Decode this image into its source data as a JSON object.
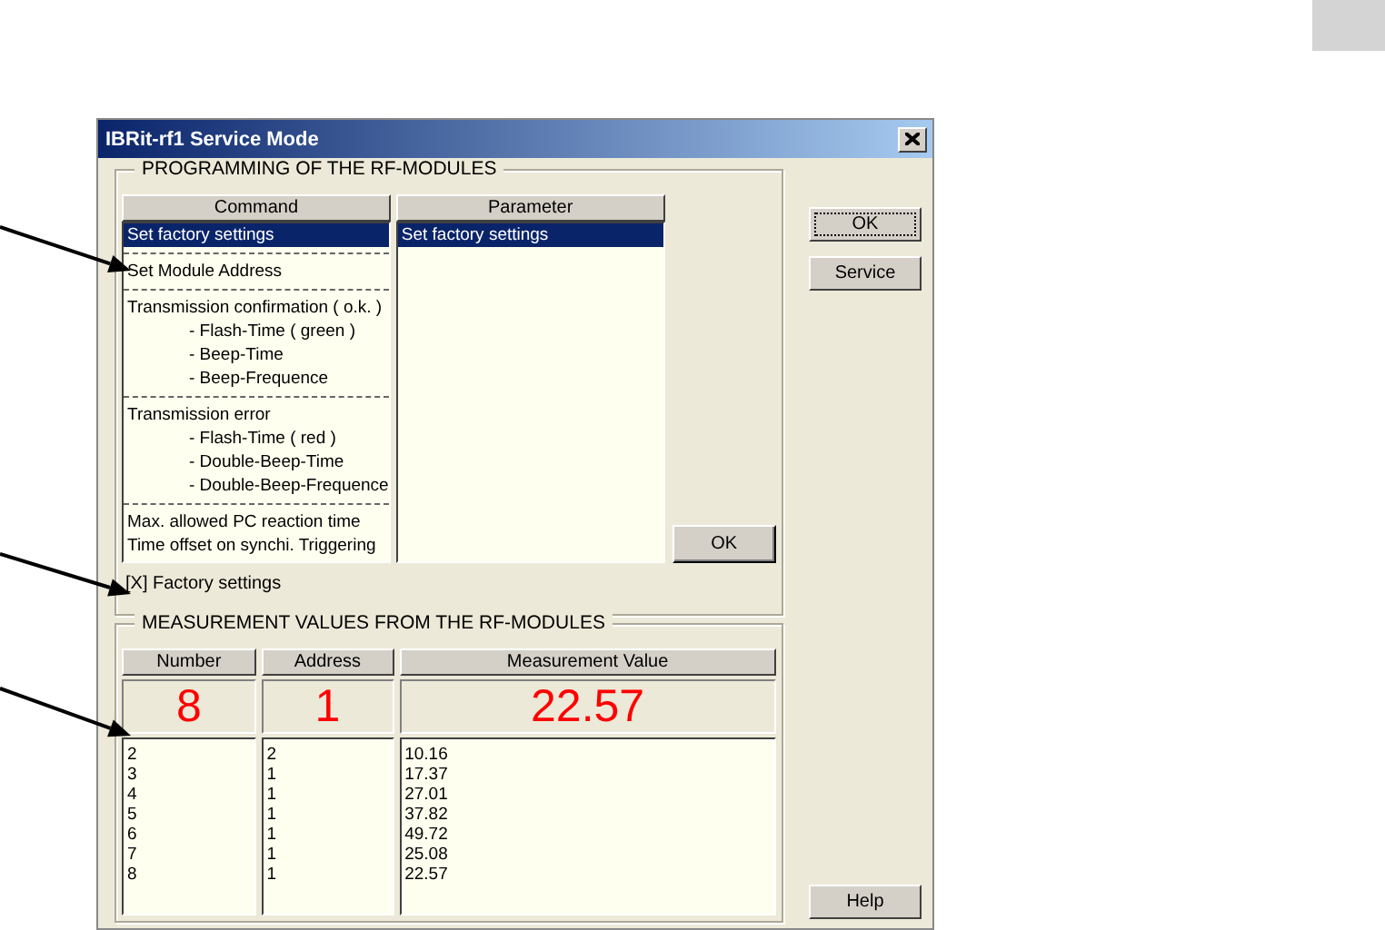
{
  "window": {
    "title": "IBRit-rf1 Service Mode"
  },
  "programming": {
    "title": "PROGRAMMING OF THE RF-MODULES",
    "columns": [
      "Command",
      "Parameter"
    ],
    "command_groups": [
      {
        "items": [
          {
            "text": "Set factory settings",
            "selected": true
          }
        ]
      },
      {
        "items": [
          {
            "text": "Set Module Address",
            "selected": false
          }
        ]
      },
      {
        "items": [
          {
            "text": "Transmission confirmation ( o.k. )",
            "selected": false,
            "children": [
              "- Flash-Time ( green )",
              "- Beep-Time",
              "- Beep-Frequence"
            ]
          }
        ]
      },
      {
        "items": [
          {
            "text": "Transmission error",
            "selected": false,
            "children": [
              "- Flash-Time ( red )",
              "- Double-Beep-Time",
              "- Double-Beep-Frequence"
            ]
          }
        ]
      },
      {
        "items": [
          {
            "text": "Max. allowed PC reaction time",
            "selected": false
          },
          {
            "text": "Time offset on synchi. Triggering",
            "selected": false
          }
        ]
      }
    ],
    "parameters": [
      {
        "text": "Set factory settings",
        "selected": true
      }
    ],
    "ok_button": "OK",
    "status_text": "[X] Factory settings"
  },
  "measurements": {
    "title": "MEASUREMENT VALUES FROM THE RF-MODULES",
    "columns": [
      "Number",
      "Address",
      "Measurement Value"
    ],
    "current": {
      "number": "8",
      "address": "1",
      "value": "22.57"
    },
    "rows": [
      {
        "number": "2",
        "address": "2",
        "value": "10.16"
      },
      {
        "number": "3",
        "address": "1",
        "value": "17.37"
      },
      {
        "number": "4",
        "address": "1",
        "value": "27.01"
      },
      {
        "number": "5",
        "address": "1",
        "value": "37.82"
      },
      {
        "number": "6",
        "address": "1",
        "value": "49.72"
      },
      {
        "number": "7",
        "address": "1",
        "value": "25.08"
      },
      {
        "number": "8",
        "address": "1",
        "value": "22.57"
      }
    ]
  },
  "side_buttons": [
    {
      "label": "OK",
      "focused": true
    },
    {
      "label": "Service",
      "focused": false
    },
    {
      "label": "Help",
      "focused": false
    }
  ]
}
